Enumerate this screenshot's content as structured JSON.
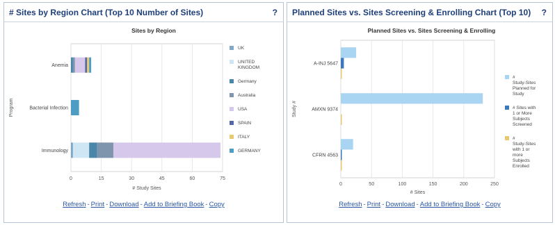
{
  "panels": [
    {
      "title": "# Sites by Region Chart (Top 10 Number of Sites)",
      "help": "?",
      "footer_links": [
        "Refresh",
        "Print",
        "Download",
        "Add to Briefing Book",
        "Copy"
      ]
    },
    {
      "title": "Planned Sites vs. Sites Screening & Enrolling Chart (Top 10)",
      "help": "?",
      "footer_links": [
        "Refresh",
        "Print",
        "Download",
        "Add to Briefing Book",
        "Copy"
      ]
    }
  ],
  "chart_data": [
    {
      "type": "bar",
      "orientation": "horizontal",
      "stacked": true,
      "title": "Sites by Region",
      "xlabel": "# Study Sites",
      "ylabel": "Program",
      "categories": [
        "Anemia",
        "Bacterial Infection",
        "Immunology"
      ],
      "xlim": [
        0,
        75
      ],
      "xticks": [
        0,
        15,
        30,
        45,
        60,
        75
      ],
      "grid": true,
      "legend_position": "right",
      "series": [
        {
          "name": "UK",
          "color": "#7fa8c9",
          "values": [
            0,
            0,
            1
          ]
        },
        {
          "name": "UNITED KINGDOM",
          "color": "#cfe6f5",
          "values": [
            0,
            0,
            8
          ]
        },
        {
          "name": "Germany",
          "color": "#4a86a8",
          "values": [
            1,
            0,
            4
          ]
        },
        {
          "name": "Australia",
          "color": "#7f95ad",
          "values": [
            1,
            0,
            8
          ]
        },
        {
          "name": "USA",
          "color": "#d5c8ea",
          "values": [
            5,
            0,
            53
          ]
        },
        {
          "name": "SPAIN",
          "color": "#5567a8",
          "values": [
            1,
            0,
            0
          ]
        },
        {
          "name": "ITALY",
          "color": "#e8c870",
          "values": [
            1,
            0,
            0
          ]
        },
        {
          "name": "GERMANY",
          "color": "#4d9cc4",
          "values": [
            1,
            4,
            0
          ]
        }
      ]
    },
    {
      "type": "bar",
      "orientation": "horizontal",
      "stacked": false,
      "title": "Planned Sites vs. Sites Screening & Enrolling",
      "xlabel": "# Sites",
      "ylabel": "Study #",
      "categories": [
        "A-INJ 5647",
        "AMXN 9374",
        "CFRN 4563"
      ],
      "xlim": [
        0,
        250
      ],
      "xticks": [
        0,
        50,
        100,
        150,
        200,
        250
      ],
      "grid": true,
      "legend_position": "right",
      "series": [
        {
          "name": "# Study-Sites Planned for Study",
          "color": "#a9d5f2",
          "values": [
            25,
            231,
            20
          ]
        },
        {
          "name": "# Sites with 1 or More Subjects Screened",
          "color": "#3d78b8",
          "values": [
            5,
            0,
            1
          ]
        },
        {
          "name": "# Study-Sites with 1 or more Subjects Enrolled",
          "color": "#e8c870",
          "values": [
            1,
            1,
            1
          ]
        }
      ]
    }
  ]
}
